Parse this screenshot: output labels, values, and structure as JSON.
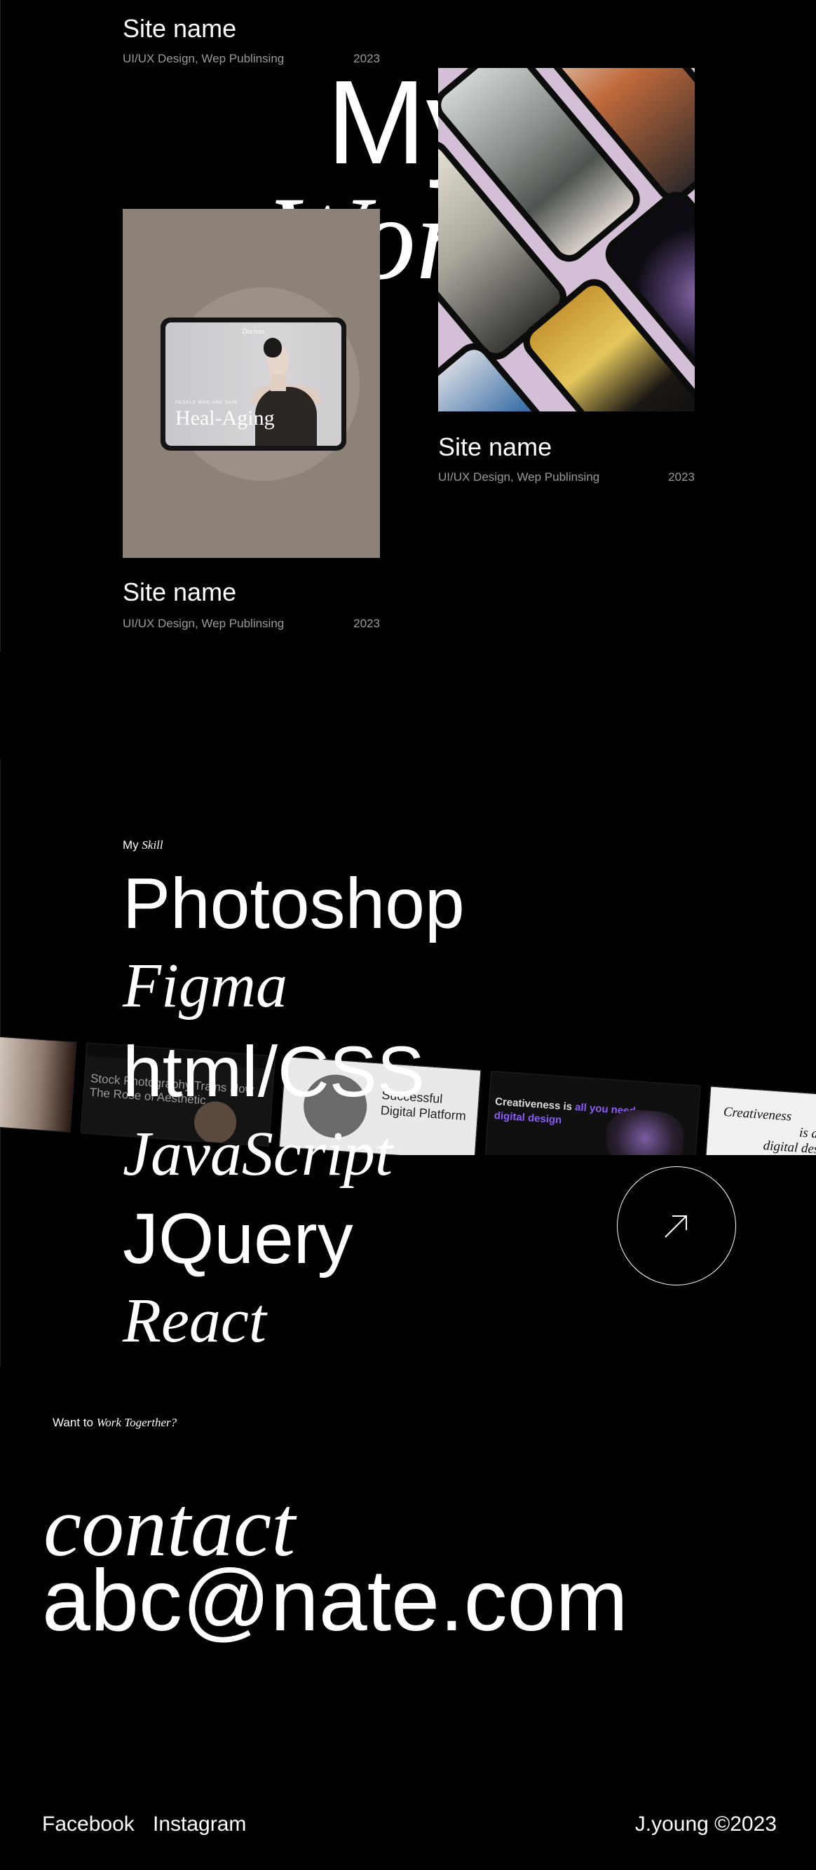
{
  "work": {
    "title_line1": "My",
    "title_line2": "Work",
    "items": [
      {
        "name": "Site name",
        "categories": "UI/UX Design, Wep Publinsing",
        "year": "2023"
      },
      {
        "name": "Site name",
        "categories": "UI/UX Design, Wep Publinsing",
        "year": "2023"
      },
      {
        "name": "Site name",
        "categories": "UI/UX Design, Wep Publinsing",
        "year": "2023"
      }
    ],
    "tablet_card": {
      "brand": "Doctors",
      "tag": "PEOPLE WHO ARE SKIN",
      "headline": "Heal-Aging"
    }
  },
  "skill": {
    "eyebrow_plain": "My",
    "eyebrow_italic": "Skill",
    "list": [
      {
        "label": "Photoshop",
        "style": "sans"
      },
      {
        "label": "Figma",
        "style": "serif"
      },
      {
        "label": "html/CSS",
        "style": "sans"
      },
      {
        "label": "JavaScript",
        "style": "serif"
      },
      {
        "label": "JQuery",
        "style": "sans"
      },
      {
        "label": "React",
        "style": "serif"
      }
    ],
    "marquee": {
      "shot1_text": "Stock Photography Trains Now The Rose of Aesthetic",
      "shot2_text": "Successful Digital Platform",
      "shot3_text_plain": "Creativeness is",
      "shot3_text_accent": "all you need",
      "shot3_text_line2": "digital design",
      "shot4_text_line1": "Creativeness",
      "shot4_text_line2": "is all you",
      "shot4_text_line3": "digital design"
    },
    "button_icon": "arrow-up-right-icon"
  },
  "contact": {
    "prompt_plain": "Want to",
    "prompt_italic": "Work Togerther?",
    "label": "contact",
    "email": "abc@nate.com"
  },
  "footer": {
    "links": [
      "Facebook",
      "Instagram"
    ],
    "copyright": "J.young ©2023"
  },
  "colors": {
    "background": "#000000",
    "text": "#ffffff",
    "muted": "#9a9a9a",
    "accent_purple": "#8a5cf6"
  }
}
